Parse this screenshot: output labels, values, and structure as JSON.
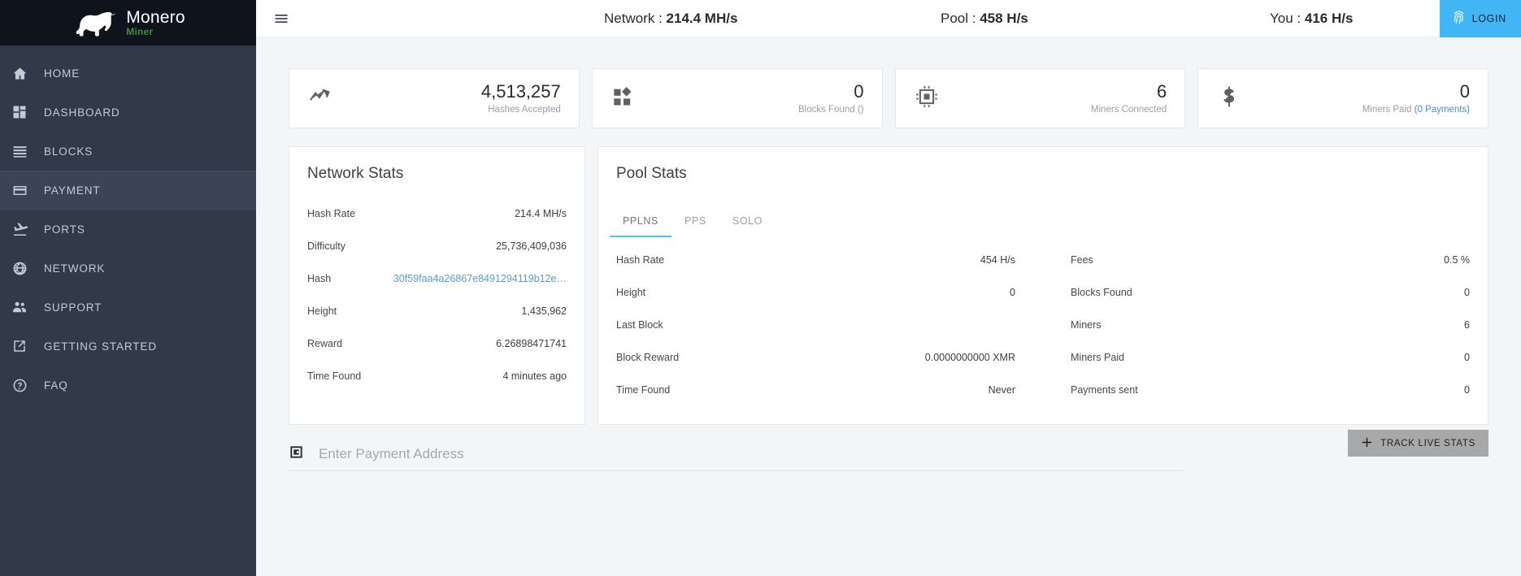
{
  "brand": {
    "name": "Monero",
    "sub": "Miner",
    "icon": "rhino-logo"
  },
  "sidebar": {
    "items": [
      {
        "label": "HOME",
        "icon": "home-icon",
        "active": false
      },
      {
        "label": "DASHBOARD",
        "icon": "dashboard-icon",
        "active": false
      },
      {
        "label": "BLOCKS",
        "icon": "blocks-icon",
        "active": false
      },
      {
        "label": "PAYMENT",
        "icon": "payment-card-icon",
        "active": true
      },
      {
        "label": "PORTS",
        "icon": "plane-landing-icon",
        "active": false
      },
      {
        "label": "NETWORK",
        "icon": "globe-icon",
        "active": false
      },
      {
        "label": "SUPPORT",
        "icon": "people-icon",
        "active": false
      },
      {
        "label": "GETTING STARTED",
        "icon": "external-link-icon",
        "active": false
      },
      {
        "label": "FAQ",
        "icon": "question-circle-icon",
        "active": false
      }
    ]
  },
  "header": {
    "menu_icon": "hamburger-icon",
    "network_label": "Network :",
    "network_value": "214.4 MH/s",
    "pool_label": "Pool :",
    "pool_value": "458 H/s",
    "you_label": "You :",
    "you_value": "416 H/s",
    "login_label": "LOGIN",
    "login_icon": "fingerprint-icon",
    "login_color": "#42b5f4"
  },
  "cards": [
    {
      "value": "4,513,257",
      "label": "Hashes Accepted",
      "label_link": "",
      "icon": "chart-line-icon"
    },
    {
      "value": "0",
      "label": "Blocks Found ()",
      "label_link": "",
      "icon": "blocks-shapes-icon"
    },
    {
      "value": "6",
      "label": "Miners Connected",
      "label_link": "",
      "icon": "cpu-chip-icon"
    },
    {
      "value": "0",
      "label": "Miners Paid ",
      "label_link": "(0 Payments)",
      "icon": "dollar-icon"
    }
  ],
  "network_stats": {
    "title": "Network Stats",
    "rows": [
      {
        "key": "Hash Rate",
        "value": "214.4 MH/s",
        "link": false
      },
      {
        "key": "Difficulty",
        "value": "25,736,409,036",
        "link": false
      },
      {
        "key": "Hash",
        "value": "30f59faa4a26867e8491294119b12e…",
        "link": true
      },
      {
        "key": "Height",
        "value": "1,435,962",
        "link": false
      },
      {
        "key": "Reward",
        "value": "6.26898471741",
        "link": false
      },
      {
        "key": "Time Found",
        "value": "4 minutes ago",
        "link": false
      }
    ]
  },
  "pool_stats": {
    "title": "Pool Stats",
    "tabs": [
      {
        "label": "PPLNS",
        "active": true
      },
      {
        "label": "PPS",
        "active": false
      },
      {
        "label": "SOLO",
        "active": false
      }
    ],
    "left_rows": [
      {
        "key": "Hash Rate",
        "value": "454 H/s"
      },
      {
        "key": "Height",
        "value": "0"
      },
      {
        "key": "Last Block",
        "value": ""
      },
      {
        "key": "Block Reward",
        "value": "0.0000000000 XMR"
      },
      {
        "key": "Time Found",
        "value": "Never"
      }
    ],
    "right_rows": [
      {
        "key": "Fees",
        "value": "0.5 %"
      },
      {
        "key": "Blocks Found",
        "value": "0"
      },
      {
        "key": "Miners",
        "value": "6"
      },
      {
        "key": "Miners Paid",
        "value": "0"
      },
      {
        "key": "Payments sent",
        "value": "0"
      }
    ]
  },
  "payment": {
    "wallet_icon": "wallet-icon",
    "placeholder": "Enter Payment Address",
    "value": "",
    "track_label": "TRACK LIVE STATS",
    "track_icon": "plus-icon"
  }
}
